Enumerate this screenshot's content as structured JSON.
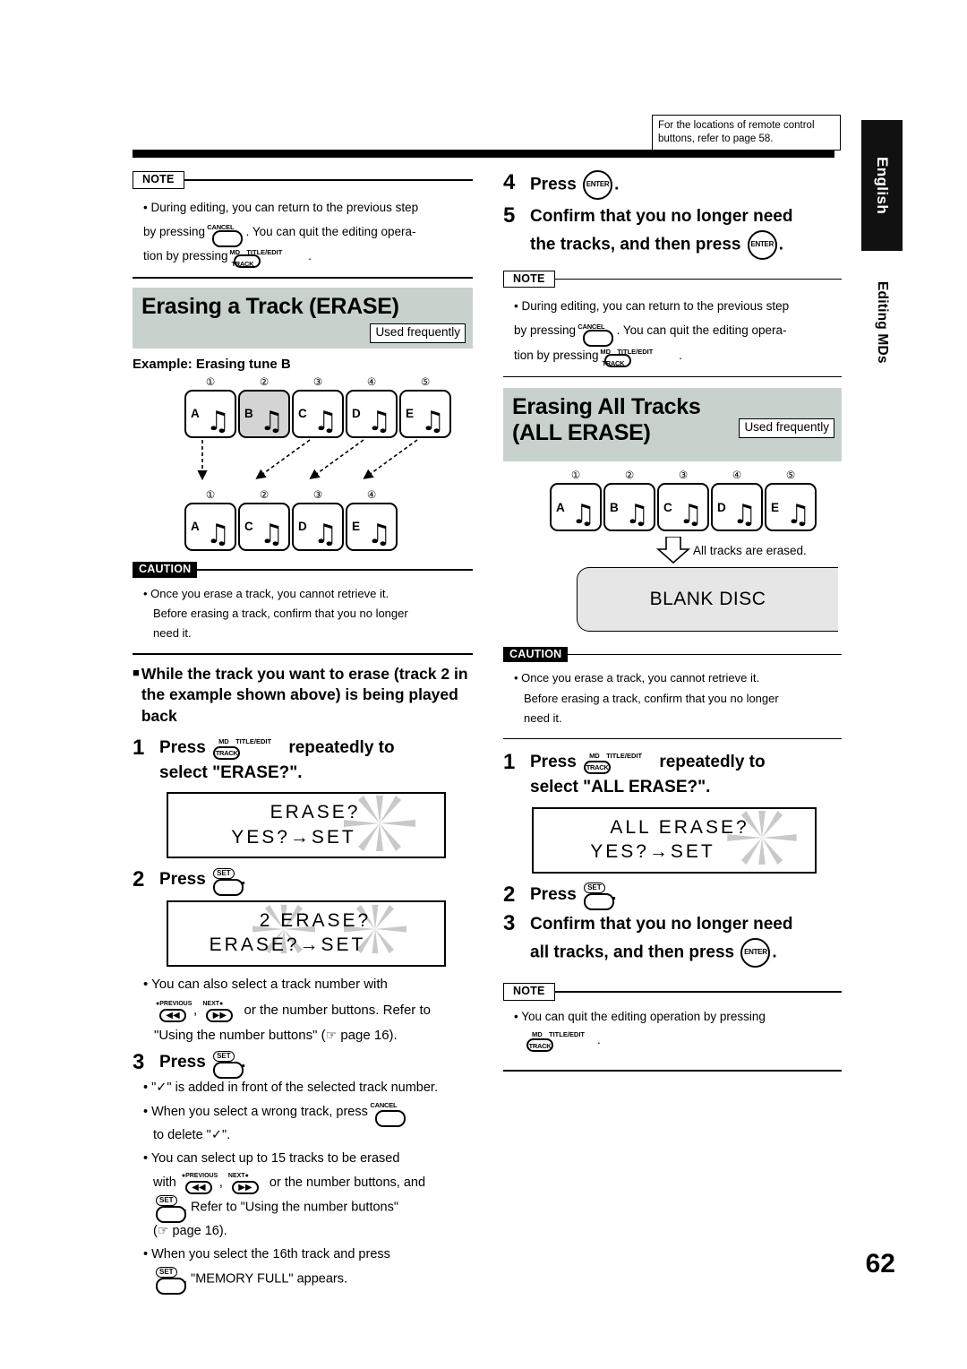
{
  "page": {
    "number": "62",
    "remote_note": "For the locations of remote control buttons, refer to page 58.",
    "tab_language": "English",
    "tab_chapter": "Editing MDs"
  },
  "icons": {
    "cancel": "CANCEL",
    "set": "SET",
    "md": "MD",
    "track": "TRACK",
    "title_edit": "TITLE/EDIT",
    "enter": "ENTER",
    "previous": "PREVIOUS",
    "next": "NEXT",
    "prev_glyph": "◀◀",
    "next_glyph": "▶▶",
    "hand_glyph": "☞",
    "check_glyph": "✓",
    "note_glyph": "♫"
  },
  "colors": {
    "section_header_bg": "#c8d2cd",
    "selected_track_bg": "#d4d4d4",
    "blank_disc_bg": "#e6e6e6",
    "tab_bg": "#111111"
  },
  "left_column": {
    "note_top": {
      "tag": "NOTE",
      "line1": "• During editing, you can return to the previous step",
      "line2_a": "by pressing",
      "line2_b": ". You can quit the editing opera-",
      "line3_a": "tion by pressing",
      "line3_b": "."
    },
    "section": {
      "title": "Erasing a Track (ERASE)",
      "badge": "Used frequently",
      "example_label": "Example: Erasing tune B"
    },
    "diagram": {
      "before": [
        {
          "num": "①",
          "letter": "A",
          "selected": false
        },
        {
          "num": "②",
          "letter": "B",
          "selected": true
        },
        {
          "num": "③",
          "letter": "C",
          "selected": false
        },
        {
          "num": "④",
          "letter": "D",
          "selected": false
        },
        {
          "num": "⑤",
          "letter": "E",
          "selected": false
        }
      ],
      "after": [
        {
          "num": "①",
          "letter": "A"
        },
        {
          "num": "②",
          "letter": "C"
        },
        {
          "num": "③",
          "letter": "D"
        },
        {
          "num": "④",
          "letter": "E"
        }
      ]
    },
    "caution": {
      "tag": "CAUTION",
      "line1": "• Once you erase a track, you cannot retrieve it.",
      "line2": "Before erasing a track, confirm that you no longer",
      "line3": "need it."
    },
    "precondition": {
      "marker": "■",
      "text": "While the track you want to erase (track 2 in the example shown above) is being played back"
    },
    "steps": [
      {
        "num": "1",
        "text_a": "Press",
        "text_b": "repeatedly to",
        "text_c": "select \"ERASE?\"."
      },
      {
        "num": "2",
        "text_a": "Press",
        "text_b": "."
      },
      {
        "num": "3",
        "text_a": "Press",
        "text_b": "."
      }
    ],
    "lcd1": {
      "line1": "ERASE?",
      "line2": "YES?→SET"
    },
    "lcd2": {
      "line1": "2 ERASE?",
      "line2": "ERASE?→SET"
    },
    "bullets_after_step2": {
      "b1_line1": "• You can also select a track number with",
      "b1_line2_mid": ",",
      "b1_line2_end": "or the number buttons. Refer to",
      "b1_line3_a": "\"Using the number buttons\" (",
      "b1_line3_b": "page 16)."
    },
    "bullets_after_step3": {
      "b1_a": "• \"",
      "b1_b": "\" is added in front of the selected track number.",
      "b2_a": "• When you select a wrong track, press",
      "b2_b": "to delete \"",
      "b2_c": "\".",
      "b3_a": "• You can select up to 15 tracks to be erased",
      "b3_with": "with",
      "b3_comma": ",",
      "b3_b": "or the number buttons, and",
      "b3_c": ". Refer to \"Using the number buttons\"",
      "b3_d": "(",
      "b3_e": "page 16).",
      "b4_a": "• When you select the 16th track and press",
      "b4_b": ", \"MEMORY FULL\" appears."
    }
  },
  "right_column": {
    "steps_top": [
      {
        "num": "4",
        "text_a": "Press",
        "text_b": "."
      },
      {
        "num": "5",
        "text_a": "Confirm that you no longer need",
        "text_b": "the tracks, and then press",
        "text_c": "."
      }
    ],
    "note_top": {
      "tag": "NOTE",
      "line1": "• During editing, you can return to the previous step",
      "line2_a": "by pressing",
      "line2_b": ". You can quit the editing opera-",
      "line3_a": "tion by pressing",
      "line3_b": "."
    },
    "section": {
      "title_line1": "Erasing All Tracks",
      "title_line2": "(ALL ERASE)",
      "badge": "Used frequently"
    },
    "diagram": {
      "tracks": [
        {
          "num": "①",
          "letter": "A"
        },
        {
          "num": "②",
          "letter": "B"
        },
        {
          "num": "③",
          "letter": "C"
        },
        {
          "num": "④",
          "letter": "D"
        },
        {
          "num": "⑤",
          "letter": "E"
        }
      ],
      "arrow_label": "All tracks are erased.",
      "result": "BLANK DISC"
    },
    "caution": {
      "tag": "CAUTION",
      "line1": "• Once you erase a track, you cannot retrieve it.",
      "line2": "Before erasing a track, confirm that you no longer",
      "line3": "need it."
    },
    "steps": [
      {
        "num": "1",
        "text_a": "Press",
        "text_b": "repeatedly to",
        "text_c": "select \"ALL ERASE?\"."
      },
      {
        "num": "2",
        "text_a": "Press",
        "text_b": "."
      },
      {
        "num": "3",
        "text_a": "Confirm that you no longer need",
        "text_b": "all tracks, and then press",
        "text_c": "."
      }
    ],
    "lcd1": {
      "line1": "ALL ERASE?",
      "line2": "YES?→SET"
    },
    "note_bottom": {
      "tag": "NOTE",
      "line1": "• You can quit the editing operation by pressing",
      "line2": "."
    }
  }
}
